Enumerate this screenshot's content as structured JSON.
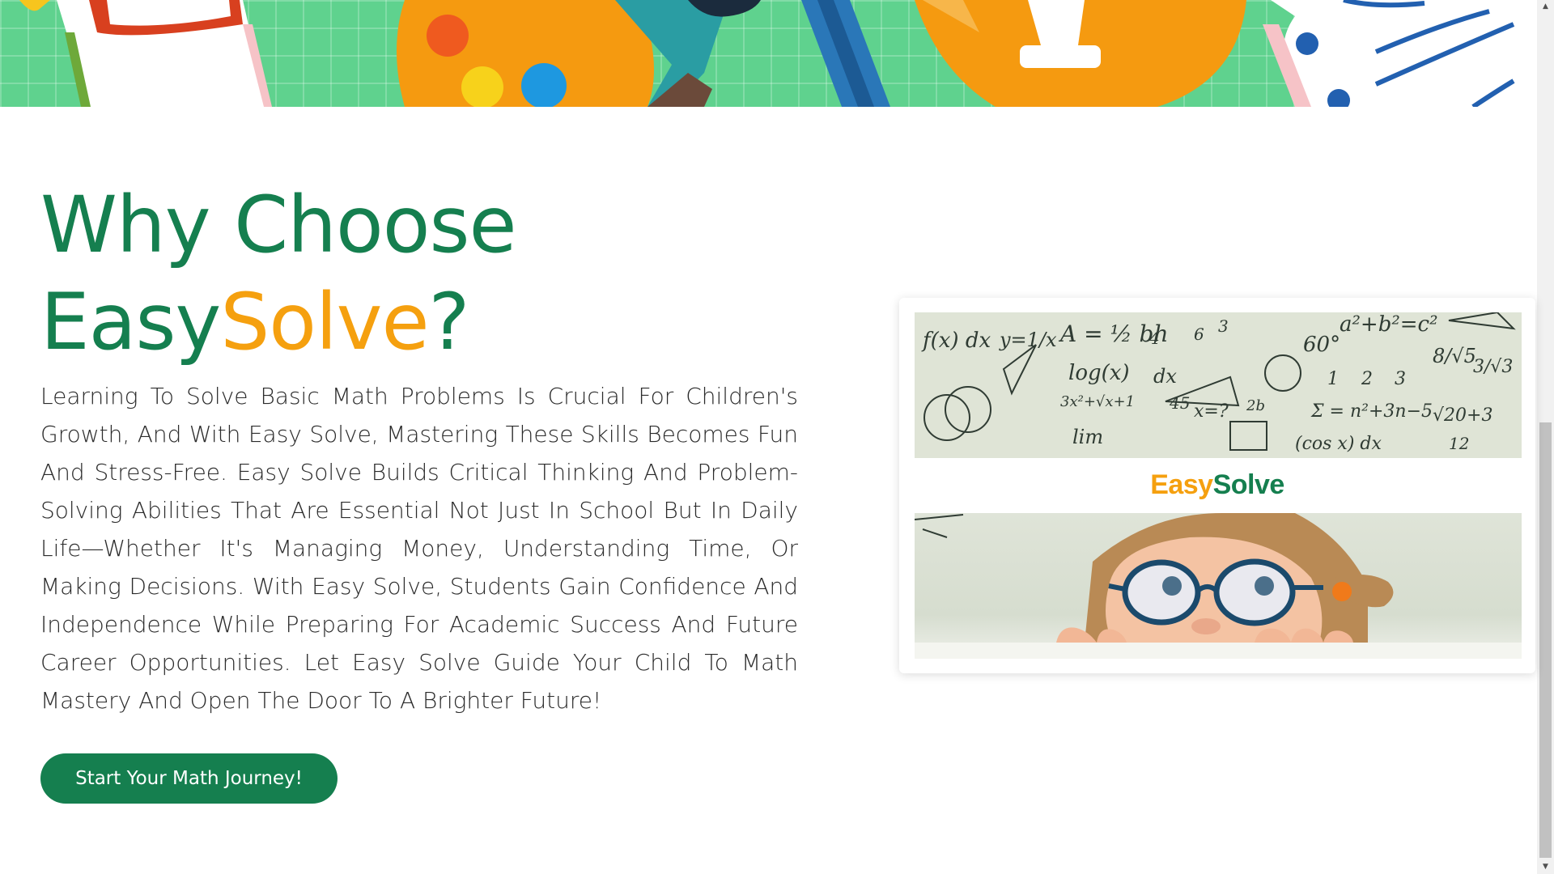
{
  "section": {
    "heading_line1": "Why Choose",
    "heading_brand_part1": "Easy",
    "heading_brand_part2": "Solve",
    "heading_suffix": "?",
    "description": "Learning To Solve Basic Math Problems Is Crucial For Children's Growth, And With Easy Solve, Mastering These Skills Becomes Fun And Stress-Free. Easy Solve Builds Critical Thinking And Problem-Solving Abilities That Are Essential Not Just In School But In Daily Life—Whether It's Managing Money, Understanding Time, Or Making Decisions. With Easy Solve, Students Gain Confidence And Independence While Preparing For Academic Success And Future Career Opportunities. Let Easy Solve Guide Your Child To Math Mastery And Open The Door To A Brighter Future!",
    "cta_label": "Start Your Math Journey!"
  },
  "card": {
    "logo_part1": "Easy",
    "logo_part2": "Solve",
    "board_formulas": [
      "f(x) dx",
      "y=1/x",
      "A = ½ bh",
      "4",
      "6",
      "3",
      "60°",
      "a²+b²=c²",
      "8/√5",
      "3/√3",
      "log(x)",
      "dx",
      "3x²+√x+1",
      "45",
      "x=?",
      "2b",
      "Σ = n²+3n−5",
      "√20+3",
      "lim",
      "(cos x) dx",
      "12",
      "1",
      "2",
      "3"
    ]
  },
  "colors": {
    "brand_green": "#157f4f",
    "brand_orange": "#f5a00f",
    "hero_green": "#5fd28e"
  }
}
